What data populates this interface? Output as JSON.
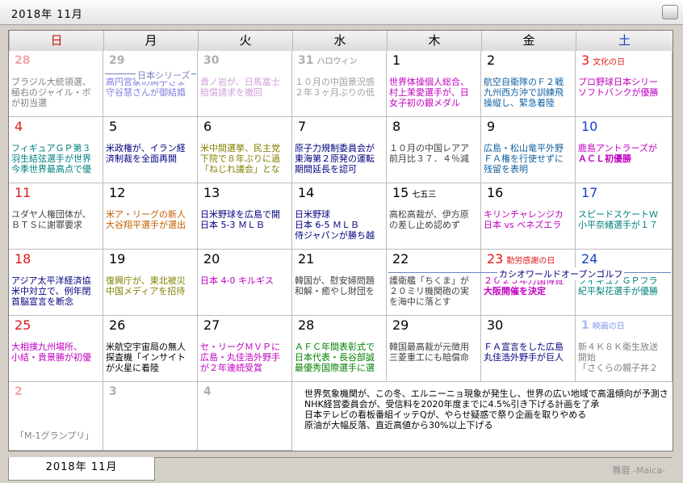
{
  "window": {
    "title": "2018年 11月"
  },
  "tab": {
    "label": "2018年 11月"
  },
  "footer": "舞暦 -Maica-",
  "weekdays": [
    "日",
    "月",
    "火",
    "水",
    "木",
    "金",
    "土"
  ],
  "colors": {
    "sunday": "#e01818",
    "saturday": "#1a40c8",
    "holiday": "#e01818"
  },
  "cells": [
    {
      "day": "28",
      "ann": "",
      "kind": "other",
      "lines": [
        {
          "t": "ブラジル大統領選、",
          "c": "#808080"
        },
        {
          "t": "極右のジャイル・ボ",
          "c": "#808080"
        },
        {
          "t": "が初当選",
          "c": "#808080"
        }
      ]
    },
    {
      "day": "29",
      "ann": "",
      "kind": "otherg",
      "lines": [
        {
          "t": "高円宮家の絢子さま",
          "c": "#8080e0"
        },
        {
          "t": "守谷慧さんが御結婚",
          "c": "#8080e0"
        }
      ]
    },
    {
      "day": "30",
      "ann": "",
      "kind": "otherg",
      "lines": [
        {
          "t": "貴ノ岩が、日馬富士",
          "c": "#d0a0d8"
        },
        {
          "t": "賠償請求を撤回",
          "c": "#d0a0d8"
        }
      ]
    },
    {
      "day": "31",
      "ann": "ハロウィン",
      "kind": "otherg",
      "lines": [
        {
          "t": "１０月の中国景況感",
          "c": "#a0a0a0"
        },
        {
          "t": "２年３ヶ月ぶりの低",
          "c": "#a0a0a0"
        }
      ]
    },
    {
      "day": "1",
      "ann": "",
      "kind": "",
      "lines": [
        {
          "t": "世界体操個人総合、",
          "c": "#c000c0"
        },
        {
          "t": "村上茉愛選手が、日",
          "c": "#c000c0"
        },
        {
          "t": "女子初の銀メダル",
          "c": "#c000c0"
        }
      ]
    },
    {
      "day": "2",
      "ann": "",
      "kind": "",
      "lines": [
        {
          "t": "航空自衛隊のＦ２戦",
          "c": "#1060a0"
        },
        {
          "t": "九州西方沖で訓練飛",
          "c": "#1060a0"
        },
        {
          "t": "操縦し、緊急着陸",
          "c": "#1060a0"
        }
      ]
    },
    {
      "day": "3",
      "ann": "文化の日",
      "kind": "hol",
      "lines": [
        {
          "t": "プロ野球日本シリー",
          "c": "#c000c0"
        },
        {
          "t": "ソフトバンクが優勝",
          "c": "#c000c0"
        }
      ]
    },
    {
      "day": "4",
      "ann": "",
      "kind": "sun",
      "lines": [
        {
          "t": "フィギュアＧＰ第３",
          "c": "#008080"
        },
        {
          "t": "羽生結弦選手が世界",
          "c": "#008080"
        },
        {
          "t": "今季世界最高点で優",
          "c": "#008080"
        }
      ]
    },
    {
      "day": "5",
      "ann": "",
      "kind": "",
      "lines": [
        {
          "t": "米政権が、イラン経",
          "c": "#000080"
        },
        {
          "t": "済制裁を全面再開",
          "c": "#000080"
        }
      ]
    },
    {
      "day": "6",
      "ann": "",
      "kind": "",
      "lines": [
        {
          "t": "米中間選挙、民主党",
          "c": "#808000"
        },
        {
          "t": "下院で８年ぶりに過",
          "c": "#808000"
        },
        {
          "t": "「ねじれ議会」とな",
          "c": "#808000"
        }
      ]
    },
    {
      "day": "7",
      "ann": "",
      "kind": "",
      "lines": [
        {
          "t": "原子力規制委員会が",
          "c": "#000080"
        },
        {
          "t": "東海第２原発の運転",
          "c": "#000080"
        },
        {
          "t": "期間延長を認可",
          "c": "#000080"
        }
      ]
    },
    {
      "day": "8",
      "ann": "",
      "kind": "",
      "lines": [
        {
          "t": "１０月の中国レアア",
          "c": "#404040"
        },
        {
          "t": "前月比３７．４％減",
          "c": "#404040"
        }
      ]
    },
    {
      "day": "9",
      "ann": "",
      "kind": "",
      "lines": [
        {
          "t": "広島・松山竜平外野",
          "c": "#1060a0"
        },
        {
          "t": "ＦＡ権を行使せずに",
          "c": "#1060a0"
        },
        {
          "t": "残留を表明",
          "c": "#1060a0"
        }
      ]
    },
    {
      "day": "10",
      "ann": "",
      "kind": "sat",
      "lines": [
        {
          "t": "鹿島アントラーズが",
          "c": "#c000c0"
        },
        {
          "t": "ＡＣＬ初優勝",
          "c": "#c000c0",
          "b": true
        }
      ]
    },
    {
      "day": "11",
      "ann": "",
      "kind": "sun",
      "lines": [
        {
          "t": "ユダヤ人権団体が、",
          "c": "#404040"
        },
        {
          "t": "ＢＴＳに謝罪要求",
          "c": "#404040"
        }
      ]
    },
    {
      "day": "12",
      "ann": "",
      "kind": "",
      "lines": [
        {
          "t": "米ア・リーグの新人",
          "c": "#c06000"
        },
        {
          "t": "大谷翔平選手が選出",
          "c": "#c06000"
        }
      ]
    },
    {
      "day": "13",
      "ann": "",
      "kind": "",
      "lines": [
        {
          "t": "日米野球を広島で開",
          "c": "#000080"
        },
        {
          "t": "日本 5-3 ＭＬＢ",
          "c": "#000080"
        }
      ]
    },
    {
      "day": "14",
      "ann": "",
      "kind": "",
      "lines": [
        {
          "t": "日米野球",
          "c": "#000080"
        },
        {
          "t": "日本 6-5 ＭＬＢ",
          "c": "#000080"
        },
        {
          "t": "侍ジャパンが勝ち越",
          "c": "#000080"
        }
      ]
    },
    {
      "day": "15",
      "ann": "七五三",
      "kind": "",
      "lines": [
        {
          "t": "高松高裁が、伊方原",
          "c": "#404040"
        },
        {
          "t": "の差し止め認めず",
          "c": "#404040"
        }
      ]
    },
    {
      "day": "16",
      "ann": "",
      "kind": "",
      "lines": [
        {
          "t": "キリンチャレンジカ",
          "c": "#c000c0"
        },
        {
          "t": "日本 vs ベネズエラ",
          "c": "#c000c0"
        }
      ]
    },
    {
      "day": "17",
      "ann": "",
      "kind": "sat",
      "lines": [
        {
          "t": "スピードスケートＷ",
          "c": "#008080"
        },
        {
          "t": "小平奈緒選手が１７",
          "c": "#008080"
        }
      ]
    },
    {
      "day": "18",
      "ann": "",
      "kind": "sun",
      "lines": [
        {
          "t": "アジア太平洋経済協",
          "c": "#000080"
        },
        {
          "t": "米中対立で、例年閉",
          "c": "#000080"
        },
        {
          "t": "首脳宣言を断念",
          "c": "#000080"
        }
      ]
    },
    {
      "day": "19",
      "ann": "",
      "kind": "",
      "lines": [
        {
          "t": "復興庁が、東北被災",
          "c": "#808000"
        },
        {
          "t": "中国メディアを招待",
          "c": "#808000"
        }
      ]
    },
    {
      "day": "20",
      "ann": "",
      "kind": "",
      "lines": [
        {
          "t": "日本 4-0 キルギス",
          "c": "#c000c0"
        }
      ]
    },
    {
      "day": "21",
      "ann": "",
      "kind": "",
      "lines": [
        {
          "t": "韓国が、慰安婦問題",
          "c": "#404040"
        },
        {
          "t": "和解・癒やし財団を",
          "c": "#404040"
        }
      ]
    },
    {
      "day": "22",
      "ann": "",
      "kind": "",
      "lines": [
        {
          "t": "護衛艦「ちくま」が",
          "c": "#404040"
        },
        {
          "t": "２０ミリ機関砲の実",
          "c": "#404040"
        },
        {
          "t": "を海中に落とす",
          "c": "#404040"
        }
      ]
    },
    {
      "day": "23",
      "ann": "勤労感謝の日",
      "kind": "hol",
      "lines": [
        {
          "t": "２０２５年万国博覧",
          "c": "#c000c0"
        },
        {
          "t": "大阪開催を決定",
          "c": "#c000c0",
          "b": true
        }
      ]
    },
    {
      "day": "24",
      "ann": "",
      "kind": "sat",
      "lines": [
        {
          "t": "フィギュアＧＰフラ",
          "c": "#008080"
        },
        {
          "t": "紀平梨花選手が優勝",
          "c": "#008080"
        }
      ]
    },
    {
      "day": "25",
      "ann": "",
      "kind": "sun",
      "lines": [
        {
          "t": "大相撲九州場所、",
          "c": "#c000c0"
        },
        {
          "t": "小結・貴景勝が初優",
          "c": "#c000c0"
        }
      ]
    },
    {
      "day": "26",
      "ann": "",
      "kind": "",
      "lines": [
        {
          "t": "米航空宇宙局の無人",
          "c": "#000000"
        },
        {
          "t": "探査機「インサイト",
          "c": "#000000"
        },
        {
          "t": "が火星に着陸",
          "c": "#000000"
        }
      ]
    },
    {
      "day": "27",
      "ann": "",
      "kind": "",
      "lines": [
        {
          "t": "セ・リーグＭＶＰに",
          "c": "#c000c0"
        },
        {
          "t": "広島・丸佳浩外野手",
          "c": "#c000c0"
        },
        {
          "t": "が２年連続受賞",
          "c": "#c000c0"
        }
      ]
    },
    {
      "day": "28",
      "ann": "",
      "kind": "",
      "lines": [
        {
          "t": "ＡＦＣ年間表彰式で",
          "c": "#008000"
        },
        {
          "t": "日本代表・長谷部誠",
          "c": "#008000"
        },
        {
          "t": "最優秀国際選手に選",
          "c": "#008000"
        }
      ]
    },
    {
      "day": "29",
      "ann": "",
      "kind": "",
      "lines": [
        {
          "t": "韓国最高裁が元徴用",
          "c": "#404040"
        },
        {
          "t": "三菱重工にも賠償命",
          "c": "#404040"
        }
      ]
    },
    {
      "day": "30",
      "ann": "",
      "kind": "",
      "lines": [
        {
          "t": "ＦＡ宣言をした広島",
          "c": "#000080"
        },
        {
          "t": "丸佳浩外野手が巨人",
          "c": "#000080"
        }
      ]
    },
    {
      "day": "1",
      "ann": "映画の日",
      "kind": "others",
      "lines": [
        {
          "t": "新４Ｋ８Ｋ衛生放送",
          "c": "#808080"
        },
        {
          "t": "開始",
          "c": "#808080"
        },
        {
          "t": "「さくらの親子丼２",
          "c": "#808080"
        }
      ]
    },
    {
      "day": "2",
      "ann": "",
      "kind": "other",
      "lines": [
        {
          "t": "「M-1グランプリ」",
          "c": "#808080",
          "bottom": true
        }
      ]
    },
    {
      "day": "3",
      "ann": "",
      "kind": "otherg",
      "lines": []
    },
    {
      "day": "4",
      "ann": "",
      "kind": "otherg",
      "lines": []
    }
  ],
  "spanbars": [
    {
      "label": "日本シリーズ",
      "row": 0,
      "col": 1,
      "span": 1
    },
    {
      "label": "カシオワールドオープンゴルフ",
      "row": 3,
      "col": 4,
      "span": 3
    }
  ],
  "news": [
    "世界気象機関が、この冬、エルニーニョ現象が発生し、世界の広い地域で高温傾向が予測さ",
    "NHK経営委員会が、受信料を2020年度までに4.5%引き下げる計画を了承",
    "日本テレビの看板番組イッテQが、やらせ疑惑で祭り企画を取りやめる",
    "原油が大幅反落、直近高値から30%以上下げる"
  ]
}
